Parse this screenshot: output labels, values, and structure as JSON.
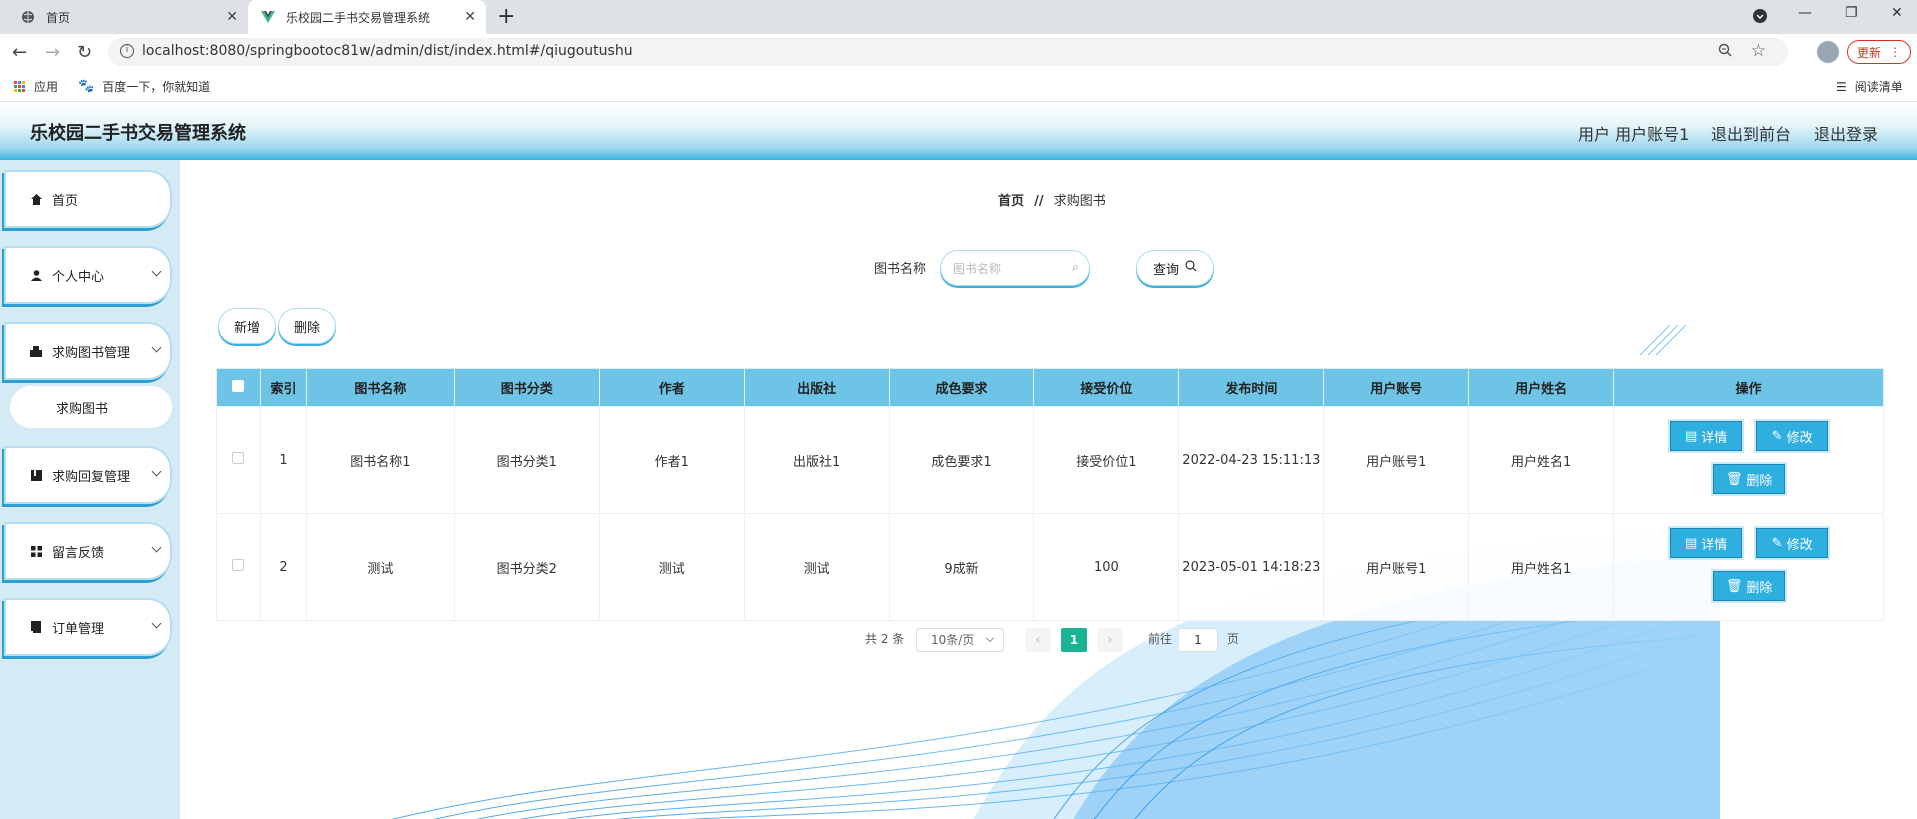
{
  "browser": {
    "tabs": [
      {
        "title": "首页"
      },
      {
        "title": "乐校园二手书交易管理系统"
      }
    ],
    "url": "localhost:8080/springbootoc81w/admin/dist/index.html#/qiugoutushu",
    "update_label": "更新",
    "bookmarks": [
      {
        "label": "应用"
      },
      {
        "label": "百度一下，你就知道"
      }
    ],
    "reading_list": "阅读清单"
  },
  "header": {
    "title": "乐校园二手书交易管理系统",
    "user": "用户 用户账号1",
    "front": "退出到前台",
    "logout": "退出登录"
  },
  "sidebar": {
    "items": [
      {
        "label": "首页",
        "icon": "home-icon"
      },
      {
        "label": "个人中心",
        "icon": "user-icon"
      },
      {
        "label": "求购图书管理",
        "icon": "book-icon"
      },
      {
        "label": "求购回复管理",
        "icon": "reply-icon"
      },
      {
        "label": "留言反馈",
        "icon": "grid-icon"
      },
      {
        "label": "订单管理",
        "icon": "order-icon"
      }
    ],
    "sub_item": "求购图书"
  },
  "breadcrumb": {
    "home": "首页",
    "sep": "//",
    "current": "求购图书"
  },
  "search": {
    "label": "图书名称",
    "placeholder": "图书名称",
    "button": "查询"
  },
  "actions": {
    "add": "新增",
    "delete": "删除"
  },
  "table": {
    "headers": [
      "索引",
      "图书名称",
      "图书分类",
      "作者",
      "出版社",
      "成色要求",
      "接受价位",
      "发布时间",
      "用户账号",
      "用户姓名",
      "操作"
    ],
    "rows": [
      {
        "cells": [
          "1",
          "图书名称1",
          "图书分类1",
          "作者1",
          "出版社1",
          "成色要求1",
          "接受价位1",
          "2022-04-23 15:11:13",
          "用户账号1",
          "用户姓名1"
        ]
      },
      {
        "cells": [
          "2",
          "测试",
          "图书分类2",
          "测试",
          "测试",
          "9成新",
          "100",
          "2023-05-01 14:18:23",
          "用户账号1",
          "用户姓名1"
        ]
      }
    ],
    "ops": {
      "detail": "详情",
      "edit": "修改",
      "delete": "删除"
    }
  },
  "pagination": {
    "total": "共 2 条",
    "page_size": "10条/页",
    "current_page": "1",
    "goto_label": "前往",
    "goto_value": "1",
    "page_suffix": "页"
  },
  "colors": {
    "header_gradient_end": "#3ab3e0",
    "table_header": "#6ec4e7",
    "op_button": "#2faee0",
    "page_active": "#1ab394",
    "sidebar_bg": "#d4ebf5"
  }
}
